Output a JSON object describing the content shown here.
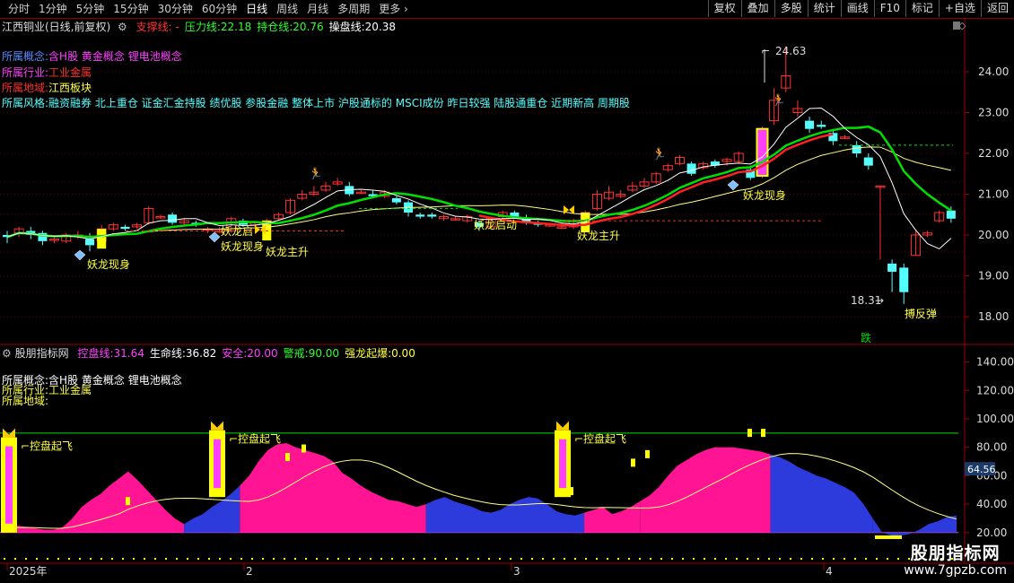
{
  "toolbar": {
    "periods": [
      "分时",
      "1分钟",
      "5分钟",
      "15分钟",
      "30分钟",
      "60分钟",
      "日线",
      "周线",
      "月线",
      "多周期",
      "更多"
    ],
    "active_period": "日线",
    "buttons": [
      "复权",
      "叠加",
      "多股",
      "统计",
      "画线",
      "F10",
      "标记",
      "+自选",
      "返回"
    ]
  },
  "main": {
    "title": "江西铜业(日线,前复权)",
    "indicators": [
      {
        "label": "支撑线:",
        "value": " -",
        "color": "#ff3030"
      },
      {
        "label": "压力线:",
        "value": "22.18",
        "color": "#30ff30"
      },
      {
        "label": "持仓线:",
        "value": "20.76",
        "color": "#30ff30"
      },
      {
        "label": "操盘线:",
        "value": "20.38",
        "color": "#ffffff"
      }
    ],
    "concept_label": "所属概念:",
    "concept_value": "含H股 黄金概念 锂电池概念",
    "industry_label": "所属行业:",
    "industry_value": "工业金属",
    "region_label": "所属地域:",
    "region_value": "江西板块",
    "style_label": "所属风格:",
    "style_value": "融资融券 北上重仓 证金汇金持股 绩优股 参股金融 整体上市 沪股通标的 MSCI成份 昨日较强 陆股通重仓 近期新高 周期股",
    "y_ticks": [
      "24.00",
      "23.00",
      "22.00",
      "21.00",
      "20.00",
      "19.00",
      "18.00"
    ],
    "annotations": {
      "high": "24.63",
      "low": "18.31",
      "yaolong_xianshen": "妖龙现身",
      "yaolong_zhusheng": "妖龙主升",
      "yaolong_qi": "妖龙启",
      "yaolong_jinghua": "妖龙启动",
      "bofantan": "搏反弹",
      "die": "跌"
    }
  },
  "sub": {
    "title": "股朋指标网",
    "indicators": [
      {
        "label": "控盘线:",
        "value": "31.64",
        "color": "#ff40ff"
      },
      {
        "label": "生命线:",
        "value": "36.82",
        "color": "#ffffff"
      },
      {
        "label": "安全:",
        "value": "20.00",
        "color": "#ff40ff"
      },
      {
        "label": "警戒:",
        "value": "90.00",
        "color": "#30ff30"
      },
      {
        "label": "强龙起爆:",
        "value": "0.00",
        "color": "#ffff40"
      }
    ],
    "concept_label": "所属概念:",
    "concept_value": "含H股 黄金概念 锂电池概念",
    "industry_label": "所属行业:",
    "industry_value": "工业金属",
    "region_label": "所属地域:",
    "region_value": "",
    "y_ticks": [
      "140.00",
      "120.00",
      "100.00",
      "80.00",
      "60.00",
      "40.00",
      "20.00"
    ],
    "current_badge": "64.56",
    "kongpan_label": "控盘起飞"
  },
  "timeline": {
    "labels": [
      "2025年",
      "2",
      "3",
      "4"
    ]
  },
  "watermark": {
    "line1": "股朋指标网",
    "line2": "www.7gpzb.com"
  },
  "colors": {
    "up": "#ff3232",
    "down": "#54ffff",
    "magenta": "#ff1493",
    "blue": "#2e3bdc",
    "yellow": "#ffff00",
    "green": "#00e000"
  }
}
